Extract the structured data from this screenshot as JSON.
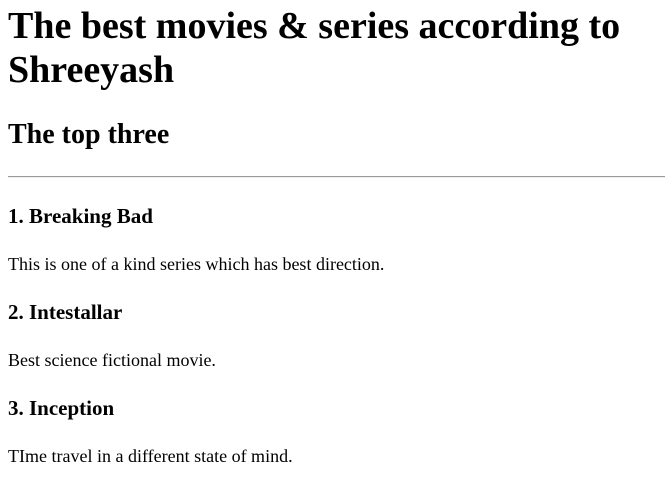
{
  "page": {
    "title": "The best movies & series according to Shreeyash",
    "subtitle": "The top three"
  },
  "items": [
    {
      "heading": "1. Breaking Bad",
      "description": "This is one of a kind series which has best direction."
    },
    {
      "heading": "2. Intestallar",
      "description": "Best science fictional movie."
    },
    {
      "heading": "3. Inception",
      "description": "TIme travel in a different state of mind."
    }
  ]
}
